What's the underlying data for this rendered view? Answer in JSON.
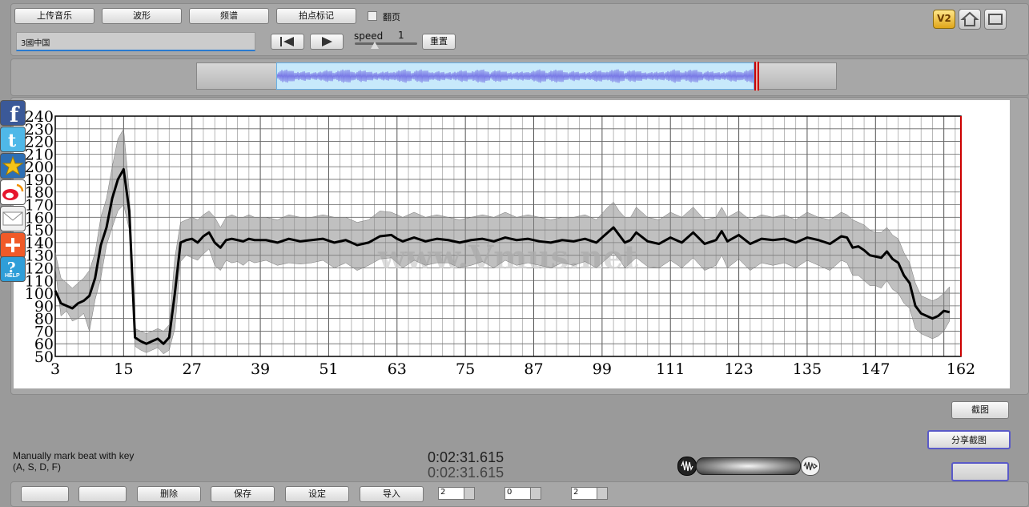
{
  "toolbar": {
    "upload_label": "上传音乐",
    "waveform_label": "波形",
    "spectrum_label": "频谱",
    "beat_mark_label": "拍点标记",
    "page_turn_label": "翻页",
    "song_name": "3國中国",
    "speed_label": "speed",
    "speed_value": "1",
    "reset_label": "重置",
    "v2_label": "V2",
    "help_label": "HELP"
  },
  "chart_data": {
    "type": "line",
    "title": "",
    "xlabel": "",
    "ylabel": "",
    "watermark": "www.Vmus.net",
    "xlim": [
      3,
      162
    ],
    "ylim": [
      50,
      240
    ],
    "x_ticks": [
      3,
      15,
      27,
      39,
      51,
      63,
      75,
      87,
      99,
      111,
      123,
      135,
      147,
      162
    ],
    "y_ticks": [
      50,
      60,
      70,
      80,
      90,
      100,
      110,
      120,
      130,
      140,
      150,
      160,
      170,
      180,
      190,
      200,
      210,
      220,
      230,
      240
    ],
    "grid": true,
    "series": [
      {
        "role": "mean",
        "color": "#000000",
        "x": [
          3,
          4,
          5,
          6,
          7,
          8,
          9,
          10,
          11,
          12,
          13,
          14,
          15,
          16,
          17,
          18,
          19,
          20,
          21,
          22,
          23,
          24,
          25,
          26,
          27,
          28,
          29,
          30,
          31,
          32,
          33,
          34,
          35,
          36,
          37,
          38,
          40,
          42,
          44,
          46,
          48,
          50,
          52,
          54,
          56,
          58,
          60,
          62,
          63,
          64,
          66,
          68,
          70,
          72,
          74,
          76,
          78,
          80,
          82,
          84,
          86,
          88,
          90,
          92,
          94,
          96,
          98,
          100,
          101,
          102,
          103,
          104,
          105,
          107,
          109,
          111,
          113,
          115,
          117,
          119,
          120,
          121,
          123,
          125,
          127,
          129,
          131,
          133,
          135,
          137,
          139,
          141,
          142,
          143,
          144,
          145,
          146,
          147,
          148,
          149,
          150,
          151,
          152,
          153,
          154,
          155,
          156,
          157,
          158,
          159,
          160
        ],
        "y": [
          102,
          92,
          90,
          88,
          92,
          94,
          98,
          112,
          138,
          152,
          175,
          190,
          198,
          165,
          65,
          62,
          60,
          62,
          64,
          60,
          65,
          100,
          140,
          142,
          143,
          140,
          145,
          148,
          140,
          136,
          142,
          143,
          142,
          141,
          143,
          142,
          142,
          140,
          143,
          141,
          142,
          143,
          140,
          142,
          138,
          140,
          145,
          146,
          143,
          141,
          144,
          141,
          143,
          142,
          140,
          142,
          143,
          141,
          144,
          142,
          143,
          141,
          140,
          142,
          141,
          143,
          140,
          148,
          152,
          146,
          140,
          142,
          148,
          141,
          139,
          144,
          140,
          148,
          139,
          142,
          149,
          141,
          146,
          139,
          143,
          142,
          143,
          140,
          144,
          142,
          139,
          145,
          144,
          136,
          137,
          134,
          130,
          129,
          128,
          133,
          127,
          124,
          114,
          108,
          90,
          84,
          82,
          80,
          82,
          86,
          85
        ],
        "lower": [
          120,
          82,
          86,
          78,
          80,
          84,
          70,
          95,
          112,
          138,
          152,
          165,
          170,
          150,
          58,
          55,
          53,
          55,
          57,
          52,
          55,
          72,
          125,
          130,
          128,
          126,
          131,
          135,
          122,
          118,
          126,
          124,
          125,
          122,
          126,
          124,
          126,
          122,
          124,
          123,
          124,
          126,
          120,
          124,
          118,
          122,
          127,
          128,
          124,
          120,
          126,
          122,
          124,
          124,
          120,
          122,
          125,
          120,
          126,
          122,
          124,
          122,
          120,
          124,
          122,
          125,
          120,
          128,
          132,
          127,
          120,
          124,
          128,
          121,
          120,
          126,
          120,
          128,
          118,
          122,
          130,
          120,
          127,
          118,
          124,
          122,
          124,
          120,
          126,
          122,
          118,
          126,
          124,
          114,
          114,
          110,
          106,
          106,
          104,
          110,
          103,
          100,
          92,
          88,
          72,
          68,
          66,
          64,
          66,
          70,
          78
        ],
        "upper": [
          132,
          112,
          108,
          104,
          108,
          112,
          118,
          132,
          160,
          175,
          200,
          222,
          230,
          180,
          72,
          70,
          68,
          70,
          72,
          70,
          75,
          128,
          156,
          158,
          160,
          158,
          162,
          165,
          160,
          152,
          160,
          162,
          160,
          160,
          162,
          160,
          160,
          158,
          162,
          160,
          160,
          162,
          160,
          160,
          156,
          158,
          165,
          164,
          162,
          160,
          164,
          160,
          162,
          160,
          158,
          160,
          162,
          160,
          164,
          160,
          162,
          160,
          158,
          160,
          160,
          162,
          158,
          168,
          172,
          165,
          160,
          160,
          168,
          160,
          158,
          164,
          160,
          168,
          158,
          160,
          168,
          160,
          165,
          158,
          162,
          160,
          162,
          158,
          164,
          160,
          158,
          164,
          162,
          158,
          156,
          154,
          150,
          148,
          148,
          152,
          146,
          143,
          132,
          124,
          108,
          98,
          96,
          94,
          96,
          100,
          105
        ]
      }
    ]
  },
  "status": {
    "hint_line1": "Manually mark beat with key",
    "hint_line2": "(A, S, D, F)",
    "time_primary": "0:02:31.615",
    "time_secondary": "0:02:31.615"
  },
  "right_panel": {
    "screenshot_label": "截图",
    "share_label": "分享截图"
  },
  "bottom": {
    "btn1": "删除",
    "btn2": "保存",
    "btn3": "设定",
    "btn4": "导入",
    "spin1": "2",
    "spin2": "0",
    "spin3": "2"
  }
}
